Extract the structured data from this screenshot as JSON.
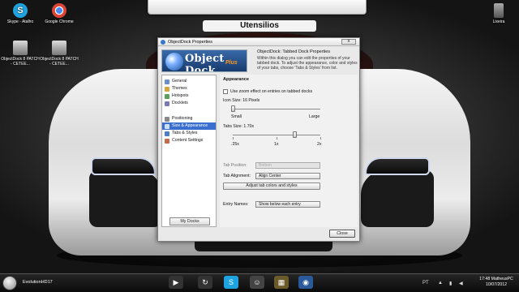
{
  "colors": {
    "accent": "#3a6fd0",
    "logo_plus": "#ff9a1e"
  },
  "dock": {
    "title": "Utensilios"
  },
  "desktop_icons": [
    {
      "label": "Skype - Atalho",
      "icon": "skype-icon"
    },
    {
      "label": "Google Chrome",
      "icon": "chrome-icon"
    },
    {
      "label": "ObjectDock 8 PATCH - CETEE...",
      "icon": "program-box-icon"
    },
    {
      "label": "ObjectDock 8 PATCH - CETEE...",
      "icon": "program-box-icon"
    },
    {
      "label": "Lixeira",
      "icon": "recycle-bin-icon"
    }
  ],
  "dialog": {
    "title": "ObjectDock Properties",
    "close_glyph": "x",
    "logo_text": "Object Dock",
    "logo_plus": "Plus",
    "header_title": "ObjectDock: Tabbed Dock Properties",
    "header_desc": "Within this dialog you can edit the properties of your tabbed dock. To adjust the appearance, color and styles of your tabs, choose 'Tabs & Styles' from list.",
    "sidebar": [
      {
        "label": "General",
        "icon": "general-icon",
        "selected": false
      },
      {
        "label": "Themes",
        "icon": "themes-icon",
        "selected": false
      },
      {
        "label": "Hotspots",
        "icon": "hotspots-icon",
        "selected": false
      },
      {
        "label": "Docklets",
        "icon": "docklets-icon",
        "selected": false
      },
      {
        "label": "Positioning",
        "icon": "positioning-icon",
        "selected": false
      },
      {
        "label": "Size & Appearance",
        "icon": "size-appearance-icon",
        "selected": true
      },
      {
        "label": "Tabs & Styles",
        "icon": "tabs-styles-icon",
        "selected": false
      },
      {
        "label": "Content Settings",
        "icon": "content-settings-icon",
        "selected": false
      }
    ],
    "my_docks": "My Docks",
    "panel": {
      "section": "Appearance",
      "zoom_checkbox": "Use zoom effect on entries on tabbed docks",
      "zoom_checked": false,
      "icon_size_label": "Icon Size: 16 Pixels",
      "icon_size_fraction": 0.0,
      "icon_small": "Small",
      "icon_large": "Large",
      "tab_size_label": "Tabs Size: 1.70x",
      "tab_size_fraction": 0.7,
      "tab_min": ".25x",
      "tab_mid": "1x",
      "tab_max": "2x",
      "tab_position_label": "Tab Position:",
      "tab_position_value": "Bottom",
      "tab_alignment_label": "Tab Alignment:",
      "tab_alignment_value": "Align Center",
      "adjust_button": "Adjust tab colors and styles",
      "entry_names_label": "Entry Names:",
      "entry_names_value": "Show below each entry"
    },
    "close_button": "Close"
  },
  "taskbar": {
    "active_app": "EvolutionHD17",
    "pinned": [
      "windows-media-icon",
      "refresh-icon",
      "skype-icon",
      "people-icon",
      "image-viewer-icon",
      "globe-icon"
    ],
    "language": "PT",
    "time": "17:48",
    "user": "MatheusPC",
    "date": "10/07/2012"
  }
}
